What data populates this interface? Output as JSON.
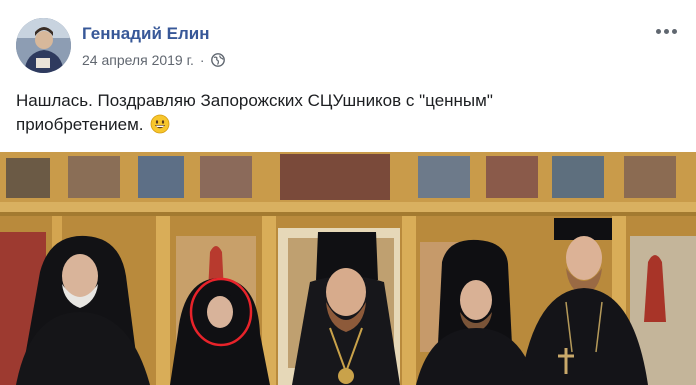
{
  "post": {
    "author": "Геннадий Елин",
    "date": "24 апреля 2019 г.",
    "separator": "·",
    "privacy_icon": "globe-icon",
    "more_icon": "more-horizontal-icon",
    "text": "Нашлась. Поздравляю Запорожских СЦУшников с \"ценным\" приобретением.",
    "emoji": "grinning-face-emoji"
  },
  "colors": {
    "author_link": "#385898",
    "meta_text": "#616770",
    "body_text": "#1c1e21",
    "highlight_circle": "#e8232a"
  }
}
